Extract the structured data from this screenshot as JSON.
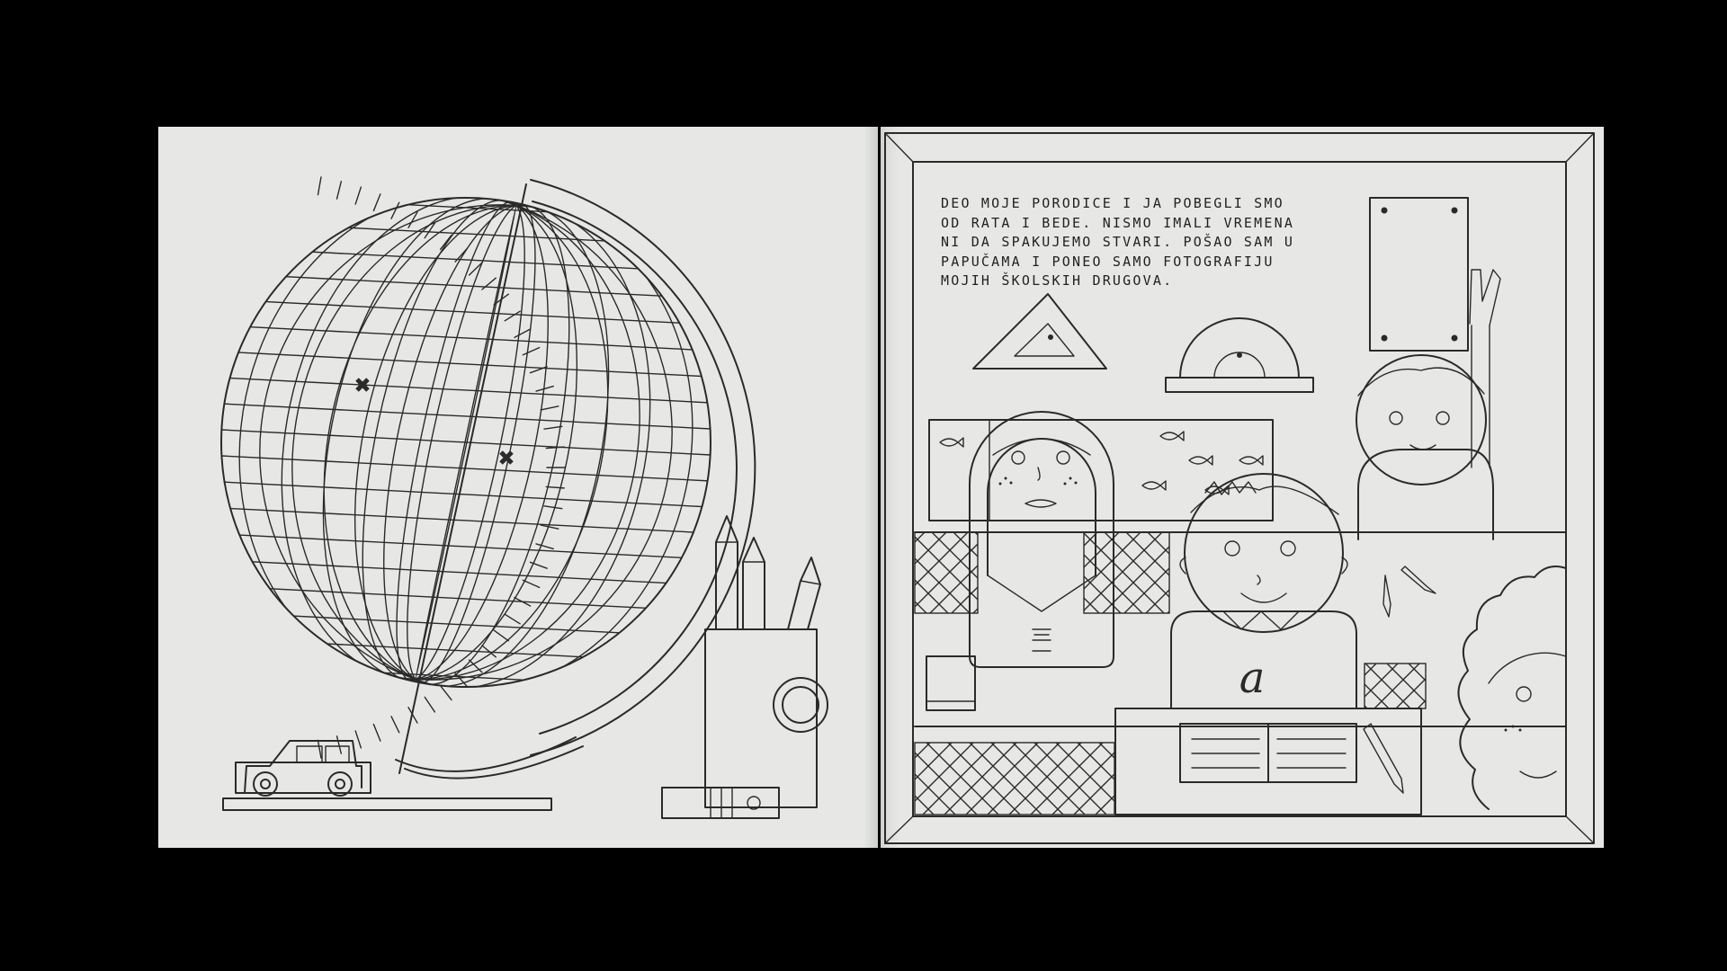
{
  "book": {
    "left_page": {
      "illustration": [
        "globe-icon",
        "pencil-cup-icon",
        "toy-car-icon",
        "book-icon"
      ]
    },
    "right_page": {
      "story_text": "DEO MOJE PORODICE I JA POBEGLI SMO\nOD RATA I BEDE.  NISMO IMALI VREMENA\nNI DA SPAKUJEMO STVARI. POŠAO SAM U\nPAPUČAMA I PONEO SAMO FOTOGRAFIJU\nMOJIH ŠKOLSKIH DRUGOVA.",
      "letter_on_shirt": "a",
      "illustration": [
        "photo-frame-icon",
        "set-square-icon",
        "protractor-icon",
        "girl-icon",
        "boy-icon",
        "book-icon",
        "pencil-icon"
      ]
    },
    "colors": {
      "background": "#000000",
      "paper": "#e7e8e6",
      "ink": "#2a2a2a"
    }
  }
}
